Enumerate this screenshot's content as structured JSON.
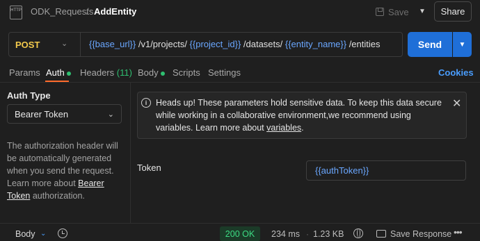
{
  "header": {
    "icon_label": "HTTP",
    "collection": "ODK_Requests",
    "separator": "/",
    "request_name": "AddEntity",
    "save_label": "Save",
    "share_label": "Share"
  },
  "request": {
    "method": "POST",
    "url_parts": [
      {
        "text": "{{base_url}}",
        "var": true
      },
      {
        "text": " /v1/projects/ ",
        "var": false
      },
      {
        "text": "{{project_id}}",
        "var": true
      },
      {
        "text": " /datasets/ ",
        "var": false
      },
      {
        "text": "{{entity_name}}",
        "var": true
      },
      {
        "text": " /entities",
        "var": false
      }
    ],
    "send_label": "Send"
  },
  "tabs": {
    "params": "Params",
    "auth": "Auth",
    "headers": "Headers",
    "headers_count": "(11)",
    "body": "Body",
    "scripts": "Scripts",
    "settings": "Settings",
    "cookies": "Cookies",
    "active": "Auth"
  },
  "auth": {
    "type_label": "Auth Type",
    "selected_type": "Bearer Token",
    "description_pre": "The authorization header will be automatically generated when you send the request. Learn more about ",
    "description_link": "Bearer Token",
    "description_post": " authorization."
  },
  "alert": {
    "text_pre": "Heads up! These parameters hold sensitive data. To keep this data secure while working in a collaborative environment,we recommend using variables. Learn more about ",
    "text_link": "variables",
    "text_post": "."
  },
  "token": {
    "label": "Token",
    "value": "{{authToken}}"
  },
  "response": {
    "body_label": "Body",
    "status": "200 OK",
    "time": "234 ms",
    "size": "1.23 KB",
    "save_response": "Save Response"
  },
  "colors": {
    "method": "#f2c94c",
    "variable": "#6aa7ff",
    "send_button": "#1f6fd8",
    "active_tab_underline": "#ff6b2b",
    "status_ok": "#3ddc84"
  }
}
